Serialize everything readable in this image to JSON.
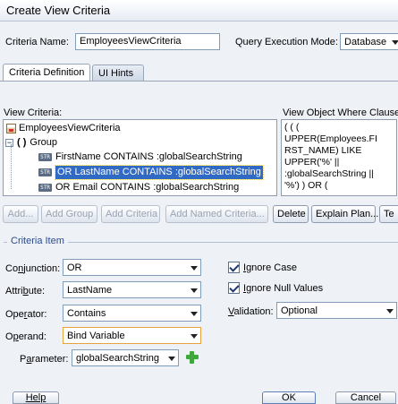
{
  "window": {
    "title": "Create View Criteria"
  },
  "header": {
    "criteria_name_label": "Criteria Name:",
    "criteria_name_value": "EmployeesViewCriteria",
    "query_mode_label": "Query Execution Mode:",
    "query_mode_value": "Database"
  },
  "tabs": [
    {
      "label": "Criteria Definition",
      "active": true
    },
    {
      "label": "UI Hints",
      "active": false
    }
  ],
  "view_criteria": {
    "label": "View Criteria:",
    "root": "EmployeesViewCriteria",
    "group": "Group",
    "items": [
      {
        "badge": "STR",
        "text": "FirstName CONTAINS :globalSearchString",
        "selected": false
      },
      {
        "badge": "STR",
        "text": "OR LastName CONTAINS :globalSearchString",
        "selected": true
      },
      {
        "badge": "STR",
        "text": "OR Email CONTAINS :globalSearchString",
        "selected": false
      }
    ]
  },
  "where_clause": {
    "label": "View Object Where Clause:",
    "lines": [
      "( ( (",
      "UPPER(Employees.FI",
      "RST_NAME) LIKE",
      "UPPER('%' ||",
      ":globalSearchString ||",
      "'%') ) OR ("
    ]
  },
  "toolbar": {
    "add": "Add...",
    "add_group": "Add Group",
    "add_criteria": "Add Criteria",
    "add_named_criteria": "Add Named Criteria...",
    "delete": "Delete",
    "explain_plan": "Explain Plan...",
    "test": "Te"
  },
  "criteria_item": {
    "title": "Criteria Item",
    "conjunction_label": "Conjunction:",
    "conjunction_value": "OR",
    "attribute_label": "Attribute:",
    "attribute_value": "LastName",
    "operator_label": "Operator:",
    "operator_value": "Contains",
    "operand_label": "Operand:",
    "operand_value": "Bind Variable",
    "parameter_label": "Parameter:",
    "parameter_value": "globalSearchString",
    "ignore_case_label": "Ignore Case",
    "ignore_case_checked": true,
    "ignore_null_label": "Ignore Null Values",
    "ignore_null_checked": true,
    "validation_label": "Validation:",
    "validation_value": "Optional"
  },
  "footer": {
    "help": "Help",
    "ok": "OK",
    "cancel": "Cancel"
  },
  "colors": {
    "selection": "#316ac5",
    "accent": "#2a4b8d",
    "add_icon": "#3fa83a"
  },
  "icons": [
    "view-criteria-icon",
    "group-icon",
    "string-attribute-icon",
    "add-icon",
    "dropdown-arrow-icon",
    "checkbox-checked-icon"
  ]
}
